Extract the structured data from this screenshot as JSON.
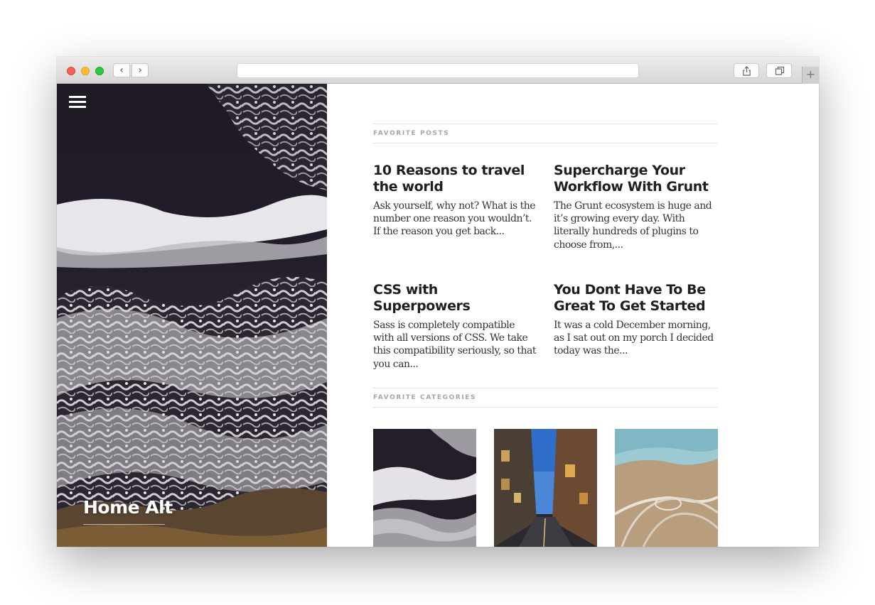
{
  "browser": {
    "back_glyph": "‹",
    "forward_glyph": "›",
    "new_tab_glyph": "+",
    "icons": [
      "close-dot",
      "minimize-dot",
      "zoom-dot",
      "chevron-left-icon",
      "chevron-right-icon",
      "share-icon",
      "tabs-icon",
      "plus-icon"
    ],
    "traffic_colors": {
      "close": "#fc5f57",
      "minimize": "#fdbc2e",
      "zoom": "#28c840"
    }
  },
  "hero": {
    "title": "Home Alt",
    "menu_icon": "hamburger-menu-icon"
  },
  "favorite_posts": {
    "heading": "FAVORITE POSTS",
    "posts": [
      {
        "title": "10 Reasons to travel the world",
        "excerpt": "Ask yourself, why not? What is the number one reason you wouldn’t. If the reason you get back..."
      },
      {
        "title": "Supercharge Your Workflow With Grunt",
        "excerpt": "The Grunt ecosystem is huge and it’s growing every day. With literally hundreds of plugins to choose from,..."
      },
      {
        "title": "CSS with Superpowers",
        "excerpt": "Sass is completely compatible with all versions of CSS. We take this compatibility seriously, so that you can..."
      },
      {
        "title": "You Dont Have To Be Great To Get Started",
        "excerpt": "It was a cold December morning, as I sat out on my porch I decided today was the..."
      }
    ]
  },
  "favorite_categories": {
    "heading": "FAVORITE CATEGORIES",
    "images": [
      "ocean-waves-image",
      "narrow-street-image",
      "highway-interchange-image"
    ]
  },
  "colors": {
    "heading_text": "#1f1f1f",
    "body_text": "#333333",
    "section_label": "#a6a6a6",
    "rule": "#e3e3e3"
  }
}
